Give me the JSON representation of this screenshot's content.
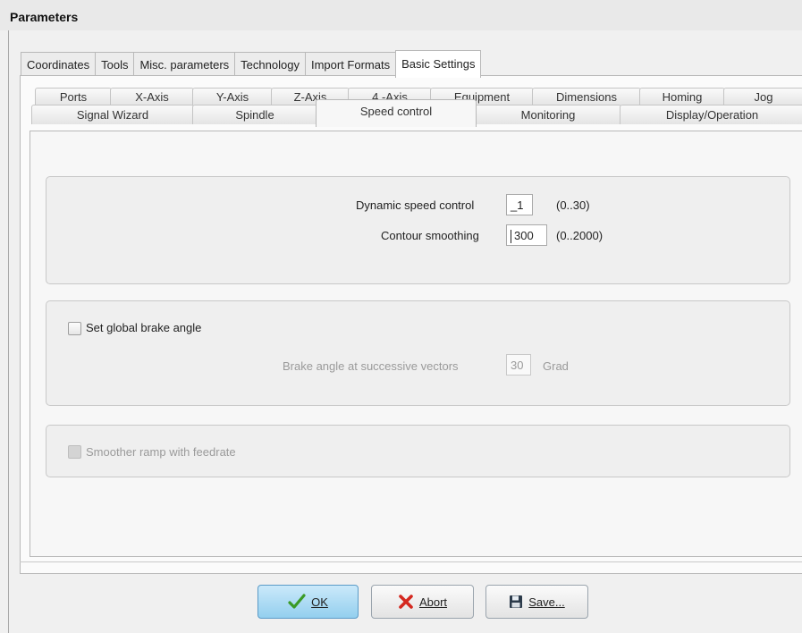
{
  "window": {
    "title": "Parameters"
  },
  "top_tabs": [
    {
      "label": "Coordinates",
      "active": false
    },
    {
      "label": "Tools",
      "active": false
    },
    {
      "label": "Misc. parameters",
      "active": false
    },
    {
      "label": "Technology",
      "active": false
    },
    {
      "label": "Import Formats",
      "active": false
    },
    {
      "label": "Basic Settings",
      "active": true
    }
  ],
  "sub_tabs_row1": [
    "Ports",
    "X-Axis",
    "Y-Axis",
    "Z-Axis",
    "4.-Axis",
    "Equipment",
    "Dimensions",
    "Homing",
    "Jog"
  ],
  "sub_tabs_row2": [
    "Signal Wizard",
    "Spindle",
    "Speed control",
    "Monitoring",
    "Display/Operation"
  ],
  "active_sub_tab": "Speed control",
  "speed_group": {
    "dynamic_label": "Dynamic speed control",
    "dynamic_value": "_1",
    "dynamic_range": "(0..30)",
    "contour_label": "Contour smoothing",
    "contour_value": "300",
    "contour_range": "(0..2000)"
  },
  "brake_group": {
    "checkbox_label": "Set global brake angle",
    "checked": false,
    "angle_label": "Brake angle at successive vectors",
    "angle_value": "30",
    "angle_unit": "Grad"
  },
  "ramp_group": {
    "checkbox_label": "Smoother ramp with feedrate",
    "checked": false,
    "enabled": false
  },
  "buttons": {
    "ok": "OK",
    "abort": "Abort",
    "save": "Save..."
  },
  "colors": {
    "ok_button": "#9fd4f0",
    "abort_icon": "#d4281f",
    "ok_icon": "#3a9a26"
  }
}
